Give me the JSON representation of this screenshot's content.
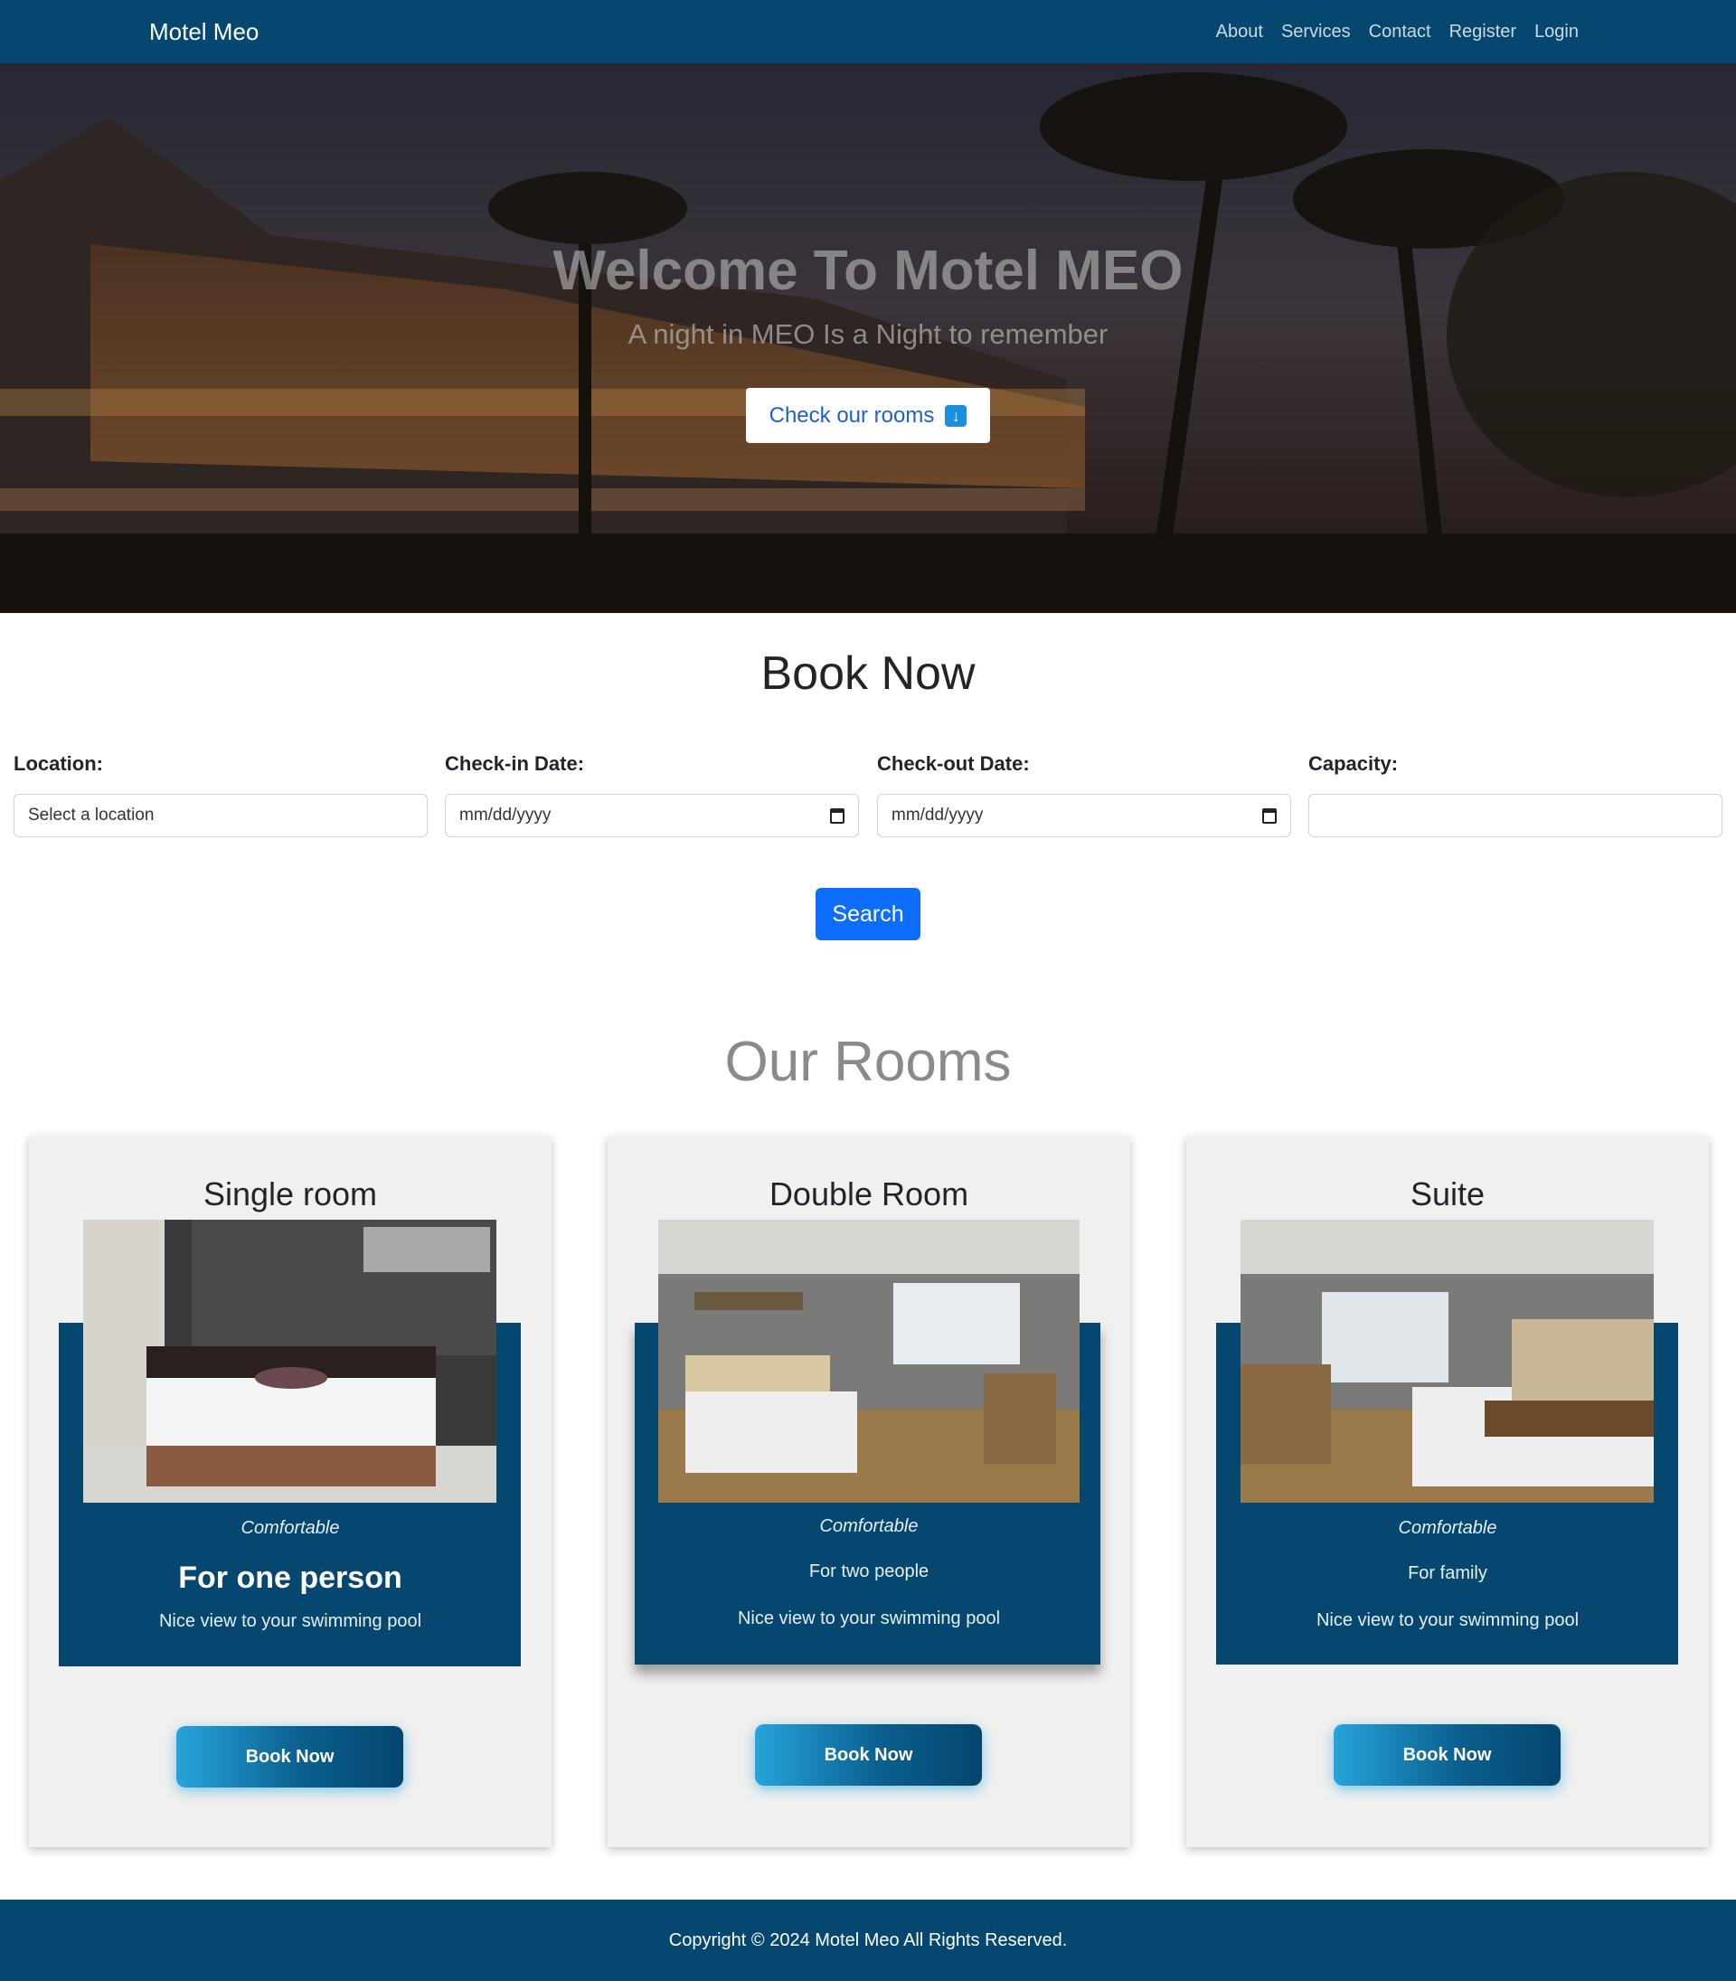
{
  "navbar": {
    "brand": "Motel Meo",
    "links": [
      "About",
      "Services",
      "Contact",
      "Register",
      "Login"
    ]
  },
  "hero": {
    "title": "Welcome To Motel MEO",
    "subtitle": "A night in MEO Is a Night to remember",
    "button_label": "Check our rooms",
    "button_icon": "arrow-down-icon"
  },
  "booking": {
    "title": "Book Now",
    "location_label": "Location:",
    "location_value": "Select a location",
    "checkin_label": "Check-in Date:",
    "checkin_placeholder": "mm/dd/yyyy",
    "checkout_label": "Check-out Date:",
    "checkout_placeholder": "mm/dd/yyyy",
    "capacity_label": "Capacity:",
    "capacity_value": "",
    "search_label": "Search"
  },
  "rooms": {
    "title": "Our Rooms",
    "items": [
      {
        "name": "Single room",
        "tag": "Comfortable",
        "people": "For one person",
        "view": "Nice view to your swimming pool",
        "button": "Book Now"
      },
      {
        "name": "Double Room",
        "tag": "Comfortable",
        "people": "For two people",
        "view": "Nice view to your swimming pool",
        "button": "Book Now"
      },
      {
        "name": "Suite",
        "tag": "Comfortable",
        "people": "For family",
        "view": "Nice view to your swimming pool",
        "button": "Book Now"
      }
    ]
  },
  "footer": {
    "copyright": "Copyright © 2024 Motel Meo All Rights Reserved."
  },
  "colors": {
    "navy": "#05476e",
    "primary": "#0d6efd",
    "card_bg": "#f0f0f0"
  }
}
